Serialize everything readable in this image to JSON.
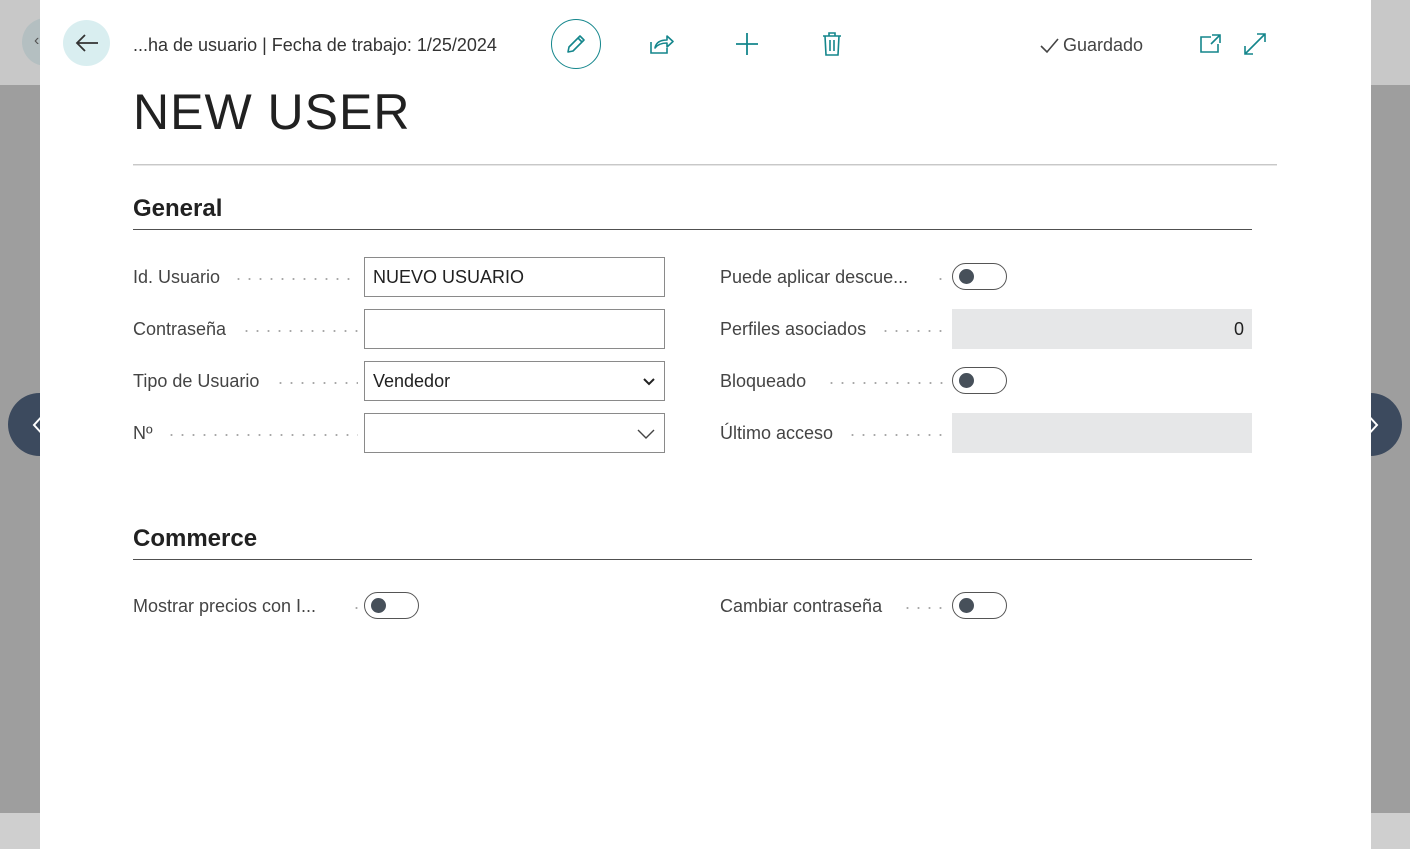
{
  "header": {
    "breadcrumb": "...ha de usuario | Fecha de trabajo: 1/25/2024",
    "saved_status": "Guardado",
    "toolbar_icons": [
      "back-arrow-icon",
      "pencil-icon",
      "share-icon",
      "plus-icon",
      "trash-icon",
      "check-icon",
      "popout-icon",
      "expand-icon"
    ]
  },
  "page": {
    "title": "NEW USER"
  },
  "general": {
    "title": "General",
    "user_id": {
      "label": "Id. Usuario",
      "value": "NUEVO USUARIO"
    },
    "password": {
      "label": "Contraseña",
      "value": ""
    },
    "user_type": {
      "label": "Tipo de Usuario",
      "value": "Vendedor"
    },
    "number": {
      "label": "Nº",
      "value": ""
    },
    "can_apply_discount": {
      "label": "Puede aplicar descue...",
      "on": false
    },
    "profiles": {
      "label": "Perfiles asociados",
      "value": "0"
    },
    "blocked": {
      "label": "Bloqueado",
      "on": false
    },
    "last_access": {
      "label": "Último acceso",
      "value": ""
    }
  },
  "commerce": {
    "title": "Commerce",
    "show_prices_vat": {
      "label": "Mostrar precios con I...",
      "on": false
    },
    "change_password": {
      "label": "Cambiar contraseña",
      "on": false
    }
  },
  "colors": {
    "accent": "#14868c",
    "nav_button": "#3c4a5e",
    "readonly_bg": "#e6e7e8"
  }
}
